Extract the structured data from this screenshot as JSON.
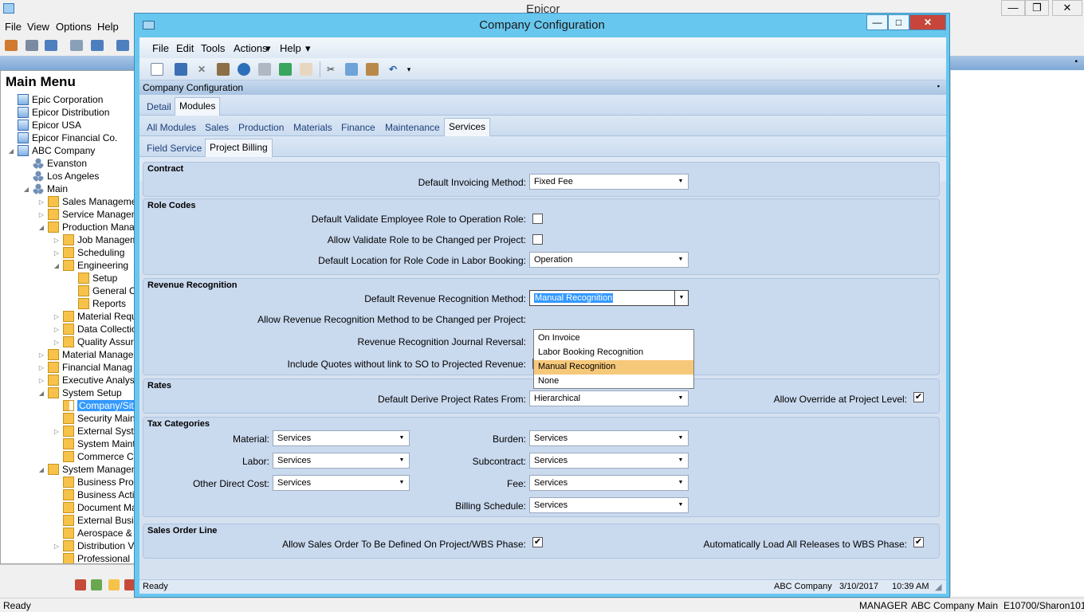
{
  "app": {
    "title": "Epicor",
    "menu": [
      "File",
      "View",
      "Options",
      "Help"
    ],
    "status": "Ready",
    "status_user": "MANAGER",
    "status_company": "ABC Company",
    "status_site": "Main",
    "status_session": "E10700/Sharon101"
  },
  "main_menu": {
    "title": "Main Menu",
    "items": [
      {
        "label": "Epic Corporation",
        "level": 1,
        "icon": "site-icon",
        "exp": ""
      },
      {
        "label": "Epicor Distribution",
        "level": 1,
        "icon": "site-icon",
        "exp": ""
      },
      {
        "label": "Epicor USA",
        "level": 1,
        "icon": "site-icon",
        "exp": ""
      },
      {
        "label": "Epicor Financial Co.",
        "level": 1,
        "icon": "site-icon",
        "exp": ""
      },
      {
        "label": "ABC Company",
        "level": 1,
        "icon": "site-icon",
        "exp": "◢"
      },
      {
        "label": "Evanston",
        "level": 2,
        "icon": "org-icon",
        "exp": ""
      },
      {
        "label": "Los Angeles",
        "level": 2,
        "icon": "org-icon",
        "exp": ""
      },
      {
        "label": "Main",
        "level": 2,
        "icon": "org-icon",
        "exp": "◢"
      },
      {
        "label": "Sales Manageme",
        "level": 3,
        "icon": "folder-icon",
        "exp": "▷"
      },
      {
        "label": "Service Managem",
        "level": 3,
        "icon": "folder-icon",
        "exp": "▷"
      },
      {
        "label": "Production Mana",
        "level": 3,
        "icon": "folder-icon",
        "exp": "◢"
      },
      {
        "label": "Job Managem",
        "level": 4,
        "icon": "folder-icon",
        "exp": "▷"
      },
      {
        "label": "Scheduling",
        "level": 4,
        "icon": "folder-icon",
        "exp": "▷"
      },
      {
        "label": "Engineering",
        "level": 4,
        "icon": "folder-icon",
        "exp": "◢"
      },
      {
        "label": "Setup",
        "level": 5,
        "icon": "folder-icon",
        "exp": ""
      },
      {
        "label": "General O",
        "level": 5,
        "icon": "folder-icon",
        "exp": ""
      },
      {
        "label": "Reports",
        "level": 5,
        "icon": "folder-icon",
        "exp": ""
      },
      {
        "label": "Material Requ",
        "level": 4,
        "icon": "folder-icon",
        "exp": "▷"
      },
      {
        "label": "Data Collectio",
        "level": 4,
        "icon": "folder-icon",
        "exp": "▷"
      },
      {
        "label": "Quality Assur",
        "level": 4,
        "icon": "folder-icon",
        "exp": "▷"
      },
      {
        "label": "Material Manager",
        "level": 3,
        "icon": "folder-icon",
        "exp": "▷"
      },
      {
        "label": "Financial Manag",
        "level": 3,
        "icon": "folder-icon",
        "exp": "▷"
      },
      {
        "label": "Executive Analys",
        "level": 3,
        "icon": "folder-icon",
        "exp": "▷"
      },
      {
        "label": "System Setup",
        "level": 3,
        "icon": "folder-icon",
        "exp": "◢"
      },
      {
        "label": "Company/Site",
        "level": 4,
        "icon": "book-icon",
        "exp": "",
        "selected": true
      },
      {
        "label": "Security Main",
        "level": 4,
        "icon": "folder-icon",
        "exp": ""
      },
      {
        "label": "External Syste",
        "level": 4,
        "icon": "folder-icon",
        "exp": "▷"
      },
      {
        "label": "System Maint",
        "level": 4,
        "icon": "folder-icon",
        "exp": ""
      },
      {
        "label": "Commerce Co",
        "level": 4,
        "icon": "folder-icon",
        "exp": ""
      },
      {
        "label": "System Managem",
        "level": 3,
        "icon": "folder-icon",
        "exp": "◢"
      },
      {
        "label": "Business Pro",
        "level": 4,
        "icon": "folder-icon",
        "exp": ""
      },
      {
        "label": "Business Acti",
        "level": 4,
        "icon": "folder-icon",
        "exp": ""
      },
      {
        "label": "Document Ma",
        "level": 4,
        "icon": "folder-icon",
        "exp": ""
      },
      {
        "label": "External Busi",
        "level": 4,
        "icon": "folder-icon",
        "exp": ""
      },
      {
        "label": "Aerospace &",
        "level": 4,
        "icon": "folder-icon",
        "exp": ""
      },
      {
        "label": "Distribution V",
        "level": 4,
        "icon": "folder-icon",
        "exp": "▷"
      },
      {
        "label": "Professional",
        "level": 4,
        "icon": "folder-icon",
        "exp": ""
      }
    ]
  },
  "dialog": {
    "title": "Company Configuration",
    "menu": [
      "File",
      "Edit",
      "Tools",
      "Actions",
      "Help"
    ],
    "header": "Company Configuration",
    "tabs_top": [
      "Detail",
      "Modules"
    ],
    "tabs_modules": [
      "All Modules",
      "Sales",
      "Production",
      "Materials",
      "Finance",
      "Maintenance",
      "Services"
    ],
    "tabs_services": [
      "Field Service",
      "Project Billing"
    ],
    "contract": {
      "title": "Contract",
      "invoicing_label": "Default Invoicing Method:",
      "invoicing_value": "Fixed Fee"
    },
    "role_codes": {
      "title": "Role Codes",
      "validate_label": "Default Validate Employee Role to Operation Role:",
      "validate_checked": false,
      "allow_change_label": "Allow Validate Role to be Changed per Project:",
      "allow_change_checked": false,
      "location_label": "Default Location for Role Code in Labor Booking:",
      "location_value": "Operation"
    },
    "revenue": {
      "title": "Revenue Recognition",
      "method_label": "Default Revenue Recognition Method:",
      "method_value": "Manual Recognition",
      "allow_change_label": "Allow Revenue Recognition Method to be Changed per Project:",
      "journal_label": "Revenue Recognition Journal Reversal:",
      "quotes_label": "Include Quotes without link to SO to Projected Revenue:",
      "options": [
        "On Invoice",
        "Labor Booking Recognition",
        "Manual Recognition",
        "None"
      ],
      "highlighted": "Manual Recognition"
    },
    "rates": {
      "title": "Rates",
      "derive_label": "Default Derive Project Rates From:",
      "derive_value": "Hierarchical",
      "override_label": "Allow Override at Project Level:",
      "override_checked": true
    },
    "tax": {
      "title": "Tax Categories",
      "material_label": "Material:",
      "material_value": "Services",
      "labor_label": "Labor:",
      "labor_value": "Services",
      "odc_label": "Other Direct Cost:",
      "odc_value": "Services",
      "burden_label": "Burden:",
      "burden_value": "Services",
      "subcontract_label": "Subcontract:",
      "subcontract_value": "Services",
      "fee_label": "Fee:",
      "fee_value": "Services",
      "billing_label": "Billing Schedule:",
      "billing_value": "Services"
    },
    "sales_order": {
      "title": "Sales Order Line",
      "define_label": "Allow Sales Order To Be Defined On Project/WBS Phase:",
      "define_checked": true,
      "autoload_label": "Automatically Load All Releases to WBS Phase:",
      "autoload_checked": true
    },
    "status": {
      "text": "Ready",
      "company": "ABC Company",
      "date": "3/10/2017",
      "time": "10:39 AM"
    }
  }
}
